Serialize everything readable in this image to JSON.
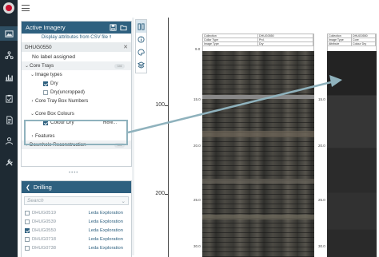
{
  "nav": {
    "items": [
      {
        "icon": "images-icon"
      },
      {
        "icon": "network-icon"
      },
      {
        "icon": "chart-icon"
      },
      {
        "icon": "clipboard-icon"
      },
      {
        "icon": "document-icon"
      },
      {
        "icon": "users-icon"
      },
      {
        "icon": "tools-icon"
      }
    ]
  },
  "imagery_panel": {
    "title": "Active Imagery",
    "csv_link": "Display attributes from CSV file",
    "hole_id": "DHUG0550",
    "no_label": "No label assigned",
    "core_trays": "Core Trays",
    "core_trays_badge": "1/4",
    "image_types": "Image types",
    "dry": "Dry",
    "dry_uncropped": "Dry(uncropped)",
    "tray_box_numbers": "Core Tray Box Numbers",
    "core_box_colours": "Core Box Colours",
    "colour_dry": "Colour Dry",
    "more": "more...",
    "features": "Features",
    "downhole_reconstruction": "Downhole Reconstruction",
    "downhole_badge": "1/4"
  },
  "drilling_panel": {
    "title": "Drilling",
    "search_placeholder": "Search",
    "rows": [
      {
        "id": "DHUG0519",
        "company": "Leda Exploration",
        "checked": false
      },
      {
        "id": "DHUG0539",
        "company": "Leda Exploration",
        "checked": false
      },
      {
        "id": "DHUG0550",
        "company": "Leda Exploration",
        "checked": true
      },
      {
        "id": "DHUG0718",
        "company": "Leda Exploration",
        "checked": false
      },
      {
        "id": "DHUG0738",
        "company": "Leda Exploration",
        "checked": false
      }
    ]
  },
  "toolbar": {
    "items": [
      {
        "icon": "grid-icon",
        "active": true
      },
      {
        "icon": "info-icon",
        "active": false
      },
      {
        "icon": "palette-icon",
        "active": false
      },
      {
        "icon": "layers-icon",
        "active": false
      }
    ]
  },
  "chart_data": {
    "type": "image-log",
    "y_ticks": [
      "100",
      "200"
    ],
    "depth_labels": [
      "9.0",
      "15.0",
      "20.0",
      "25.0",
      "30.0"
    ],
    "track1_header": [
      [
        "Collection",
        "DHUG0550"
      ],
      [
        "Collar Type",
        "Prd."
      ],
      [
        "Image Type",
        "Dry"
      ]
    ],
    "track2_header": [
      [
        "Collection",
        "DHUG0550"
      ],
      [
        "Image Type",
        "Core"
      ],
      [
        "Attribute",
        "Colour Dry"
      ]
    ]
  },
  "colors": {
    "accent": "#2e607f",
    "highlight": "#8fb2bd",
    "sidebar": "#1e2a33"
  }
}
